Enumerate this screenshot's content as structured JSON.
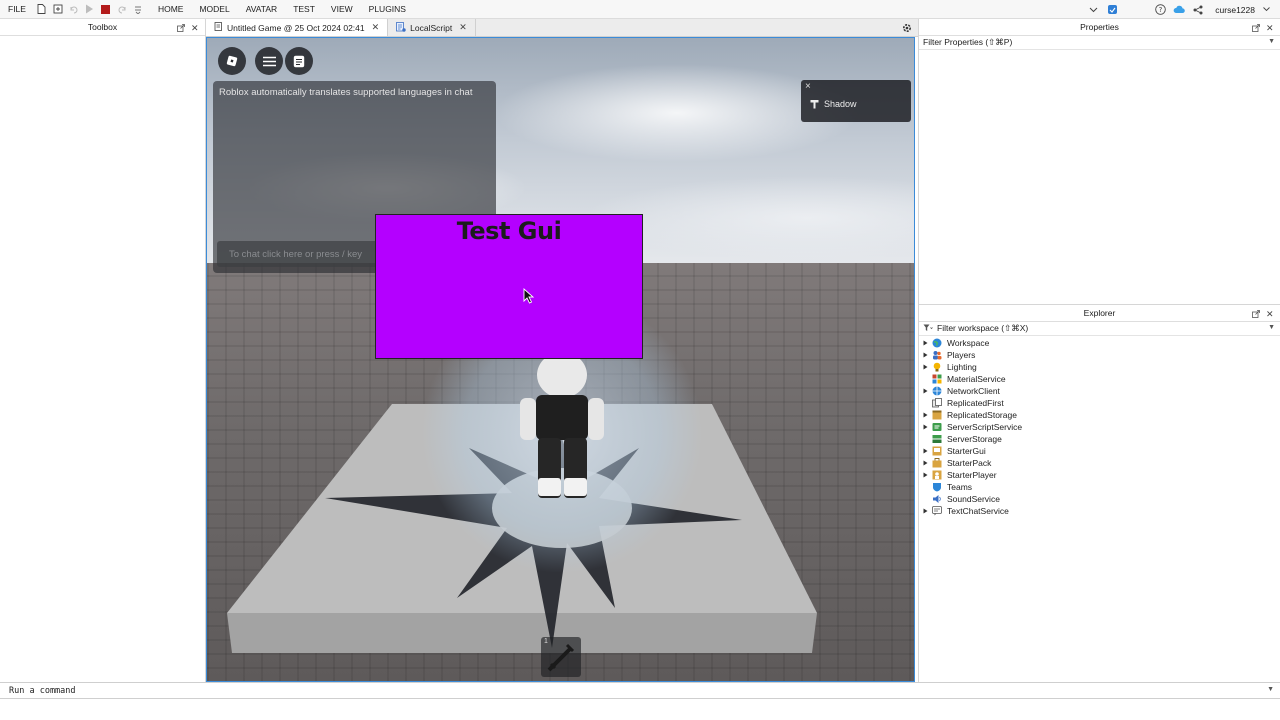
{
  "menubar": {
    "file": "FILE",
    "tabs": [
      "HOME",
      "MODEL",
      "AVATAR",
      "TEST",
      "VIEW",
      "PLUGINS"
    ],
    "username": "curse1228"
  },
  "toolbox": {
    "title": "Toolbox"
  },
  "doc_tabs": [
    {
      "label": "Untitled Game @ 25 Oct 2024 02:41"
    },
    {
      "label": "LocalScript"
    }
  ],
  "viewport": {
    "chat_notice": "Roblox automatically translates supported languages in chat",
    "chat_placeholder": "To chat click here or press / key",
    "shadow_label": "Shadow",
    "gui_title": "Test Gui",
    "hotbar_slot_number": "1"
  },
  "properties": {
    "title": "Properties",
    "filter_placeholder": "Filter Properties (⇧⌘P)"
  },
  "explorer": {
    "title": "Explorer",
    "filter_placeholder": "Filter workspace (⇧⌘X)",
    "items": [
      {
        "label": "Workspace",
        "expandable": true,
        "icon": "globe-icon"
      },
      {
        "label": "Players",
        "expandable": true,
        "icon": "players-icon"
      },
      {
        "label": "Lighting",
        "expandable": true,
        "icon": "lightbulb-icon"
      },
      {
        "label": "MaterialService",
        "expandable": false,
        "icon": "material-icon"
      },
      {
        "label": "NetworkClient",
        "expandable": true,
        "icon": "network-icon"
      },
      {
        "label": "ReplicatedFirst",
        "expandable": false,
        "icon": "replicated-icon"
      },
      {
        "label": "ReplicatedStorage",
        "expandable": true,
        "icon": "storage-icon"
      },
      {
        "label": "ServerScriptService",
        "expandable": true,
        "icon": "script-service-icon"
      },
      {
        "label": "ServerStorage",
        "expandable": false,
        "icon": "server-storage-icon"
      },
      {
        "label": "StarterGui",
        "expandable": true,
        "icon": "starter-gui-icon"
      },
      {
        "label": "StarterPack",
        "expandable": true,
        "icon": "starter-pack-icon"
      },
      {
        "label": "StarterPlayer",
        "expandable": true,
        "icon": "starter-player-icon"
      },
      {
        "label": "Teams",
        "expandable": false,
        "icon": "teams-icon"
      },
      {
        "label": "SoundService",
        "expandable": false,
        "icon": "sound-icon"
      },
      {
        "label": "TextChatService",
        "expandable": true,
        "icon": "text-chat-icon"
      }
    ]
  },
  "command_bar": {
    "placeholder": "Run a command"
  },
  "colors": {
    "gui_frame": "#b400ff",
    "viewport_border": "#3b8bd8",
    "record_button": "#b31b1b"
  }
}
